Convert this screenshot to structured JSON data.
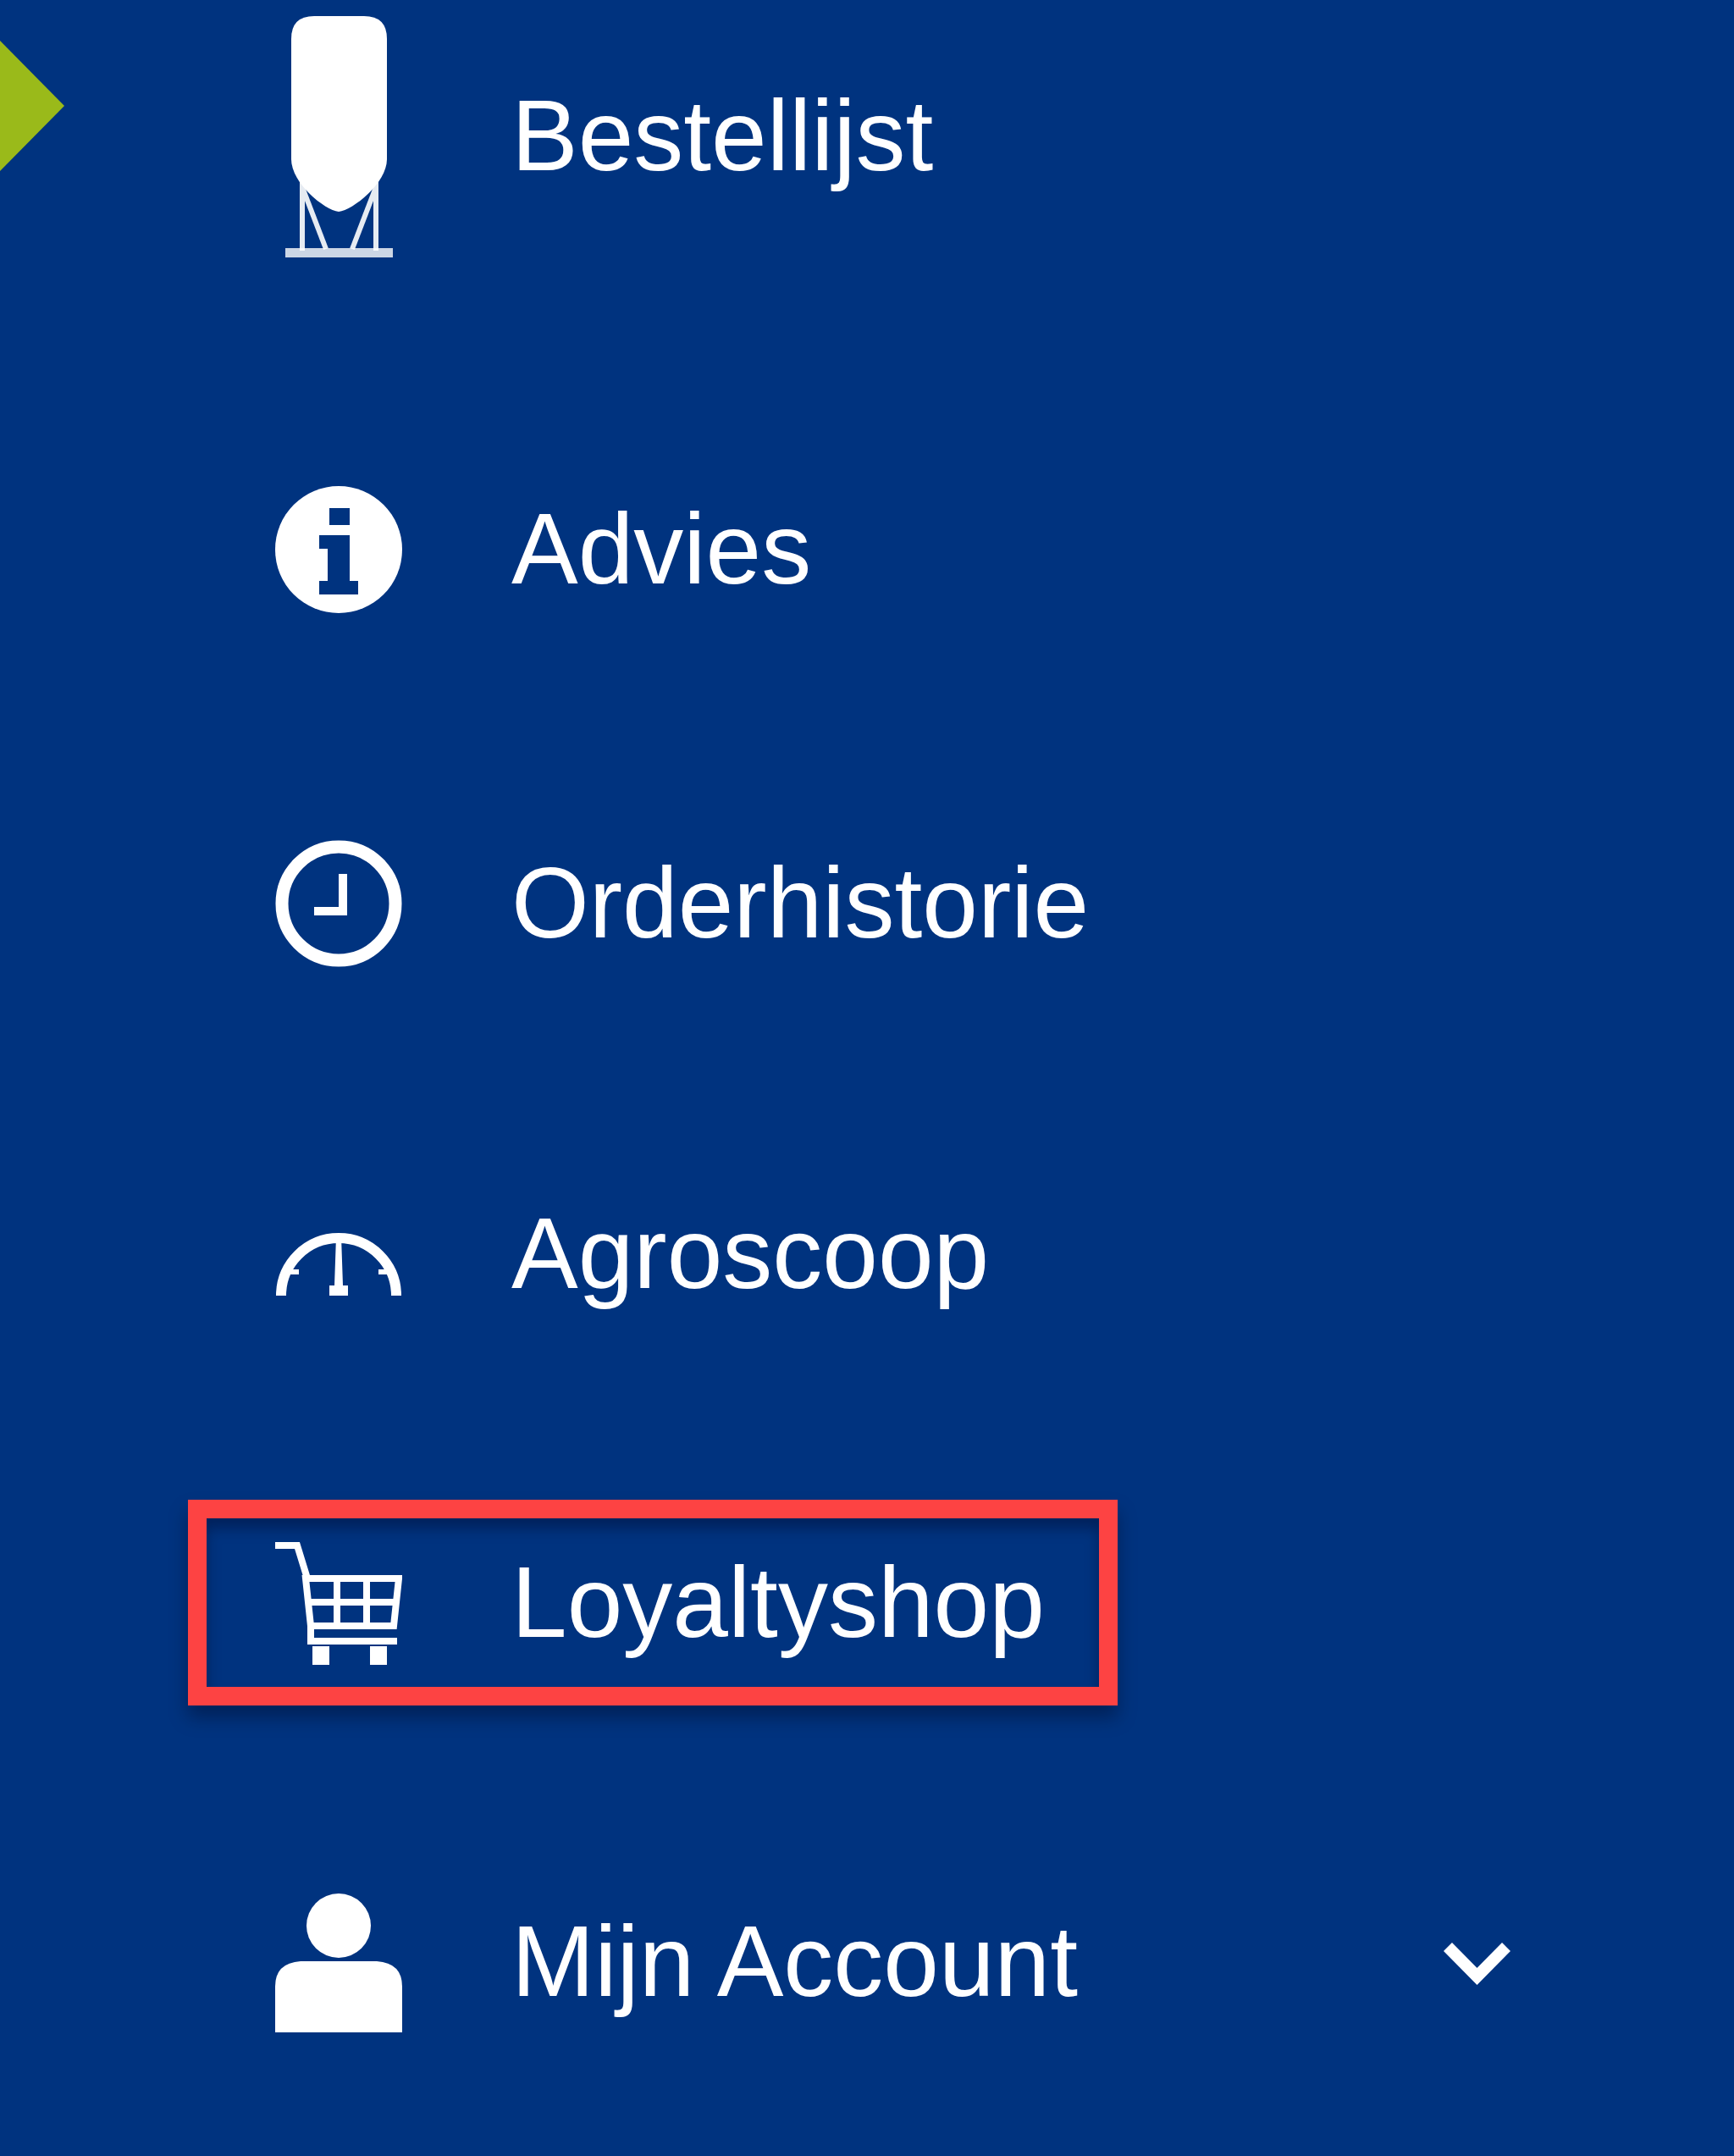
{
  "sidebar": {
    "items": [
      {
        "label": "Bestellijst",
        "kind": "link",
        "selected": true,
        "highlighted": false
      },
      {
        "label": "Advies",
        "kind": "link",
        "selected": false,
        "highlighted": false
      },
      {
        "label": "Orderhistorie",
        "kind": "link",
        "selected": false,
        "highlighted": false
      },
      {
        "label": "Agroscoop",
        "kind": "link",
        "selected": false,
        "highlighted": false
      },
      {
        "label": "Loyaltyshop",
        "kind": "link",
        "selected": false,
        "highlighted": true
      },
      {
        "label": "Mijn Account",
        "kind": "dropdown",
        "selected": false,
        "highlighted": false,
        "expanded": false
      }
    ]
  }
}
